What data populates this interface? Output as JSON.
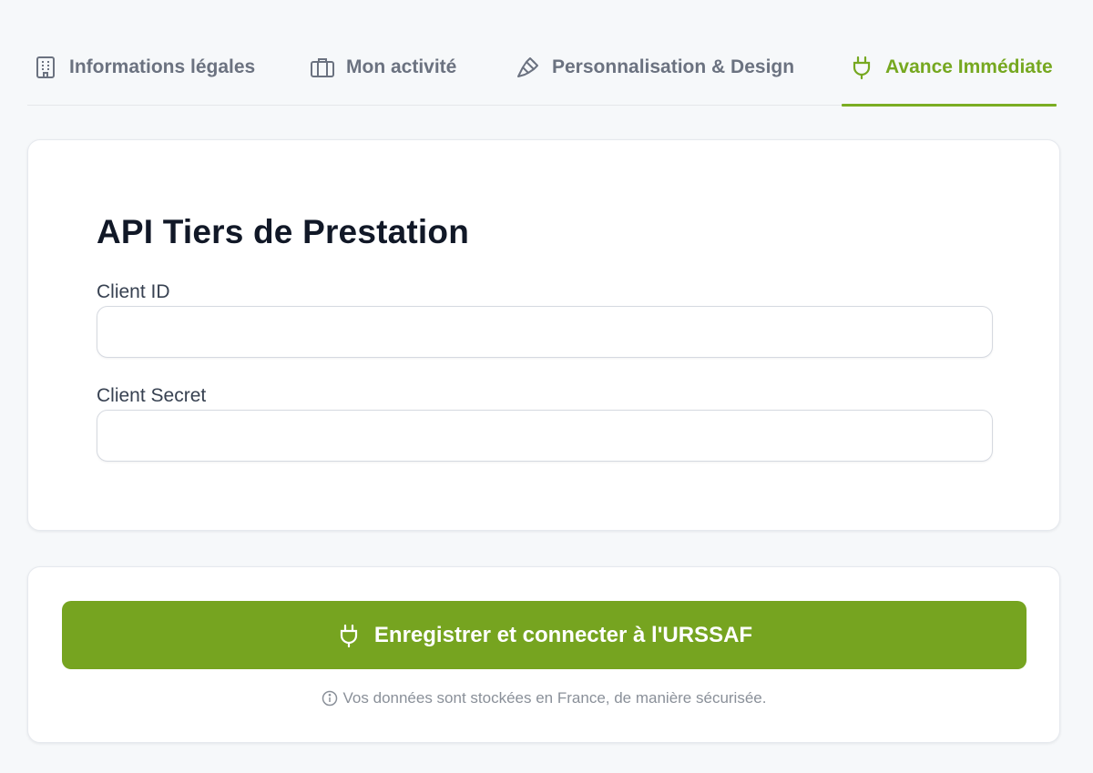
{
  "tabs": [
    {
      "label": "Informations légales",
      "icon": "building-icon",
      "active": false
    },
    {
      "label": "Mon activité",
      "icon": "briefcase-icon",
      "active": false
    },
    {
      "label": "Personnalisation & Design",
      "icon": "paintbrush-icon",
      "active": false
    },
    {
      "label": "Avance Immédiate",
      "icon": "plug-icon",
      "active": true
    }
  ],
  "form": {
    "title": "API Tiers de Prestation",
    "client_id": {
      "label": "Client ID",
      "value": "",
      "placeholder": ""
    },
    "client_secret": {
      "label": "Client Secret",
      "value": "",
      "placeholder": ""
    }
  },
  "action": {
    "button_label": "Enregistrer et connecter à l'URSSAF",
    "button_icon": "plug-icon",
    "note_icon": "info-icon",
    "note": "Vos données sont stockées en France, de manière sécurisée."
  },
  "colors": {
    "accent": "#76a420",
    "active_tab": "#76a820",
    "tab_inactive": "#6b7280",
    "background": "#f6f8fa"
  }
}
